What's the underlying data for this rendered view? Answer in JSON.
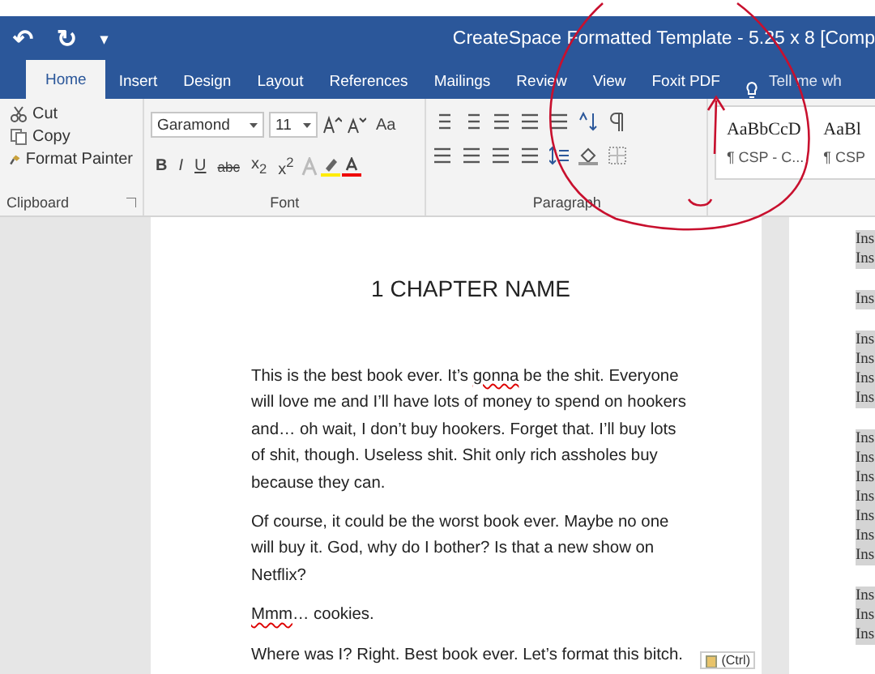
{
  "quick_access": {
    "undo": "↶",
    "redo": "↻",
    "customize": "▾"
  },
  "window": {
    "title": "CreateSpace Formatted Template - 5.25 x 8 [Comp"
  },
  "tabs": [
    {
      "label": "Home",
      "selected": true
    },
    {
      "label": "Insert",
      "selected": false
    },
    {
      "label": "Design",
      "selected": false
    },
    {
      "label": "Layout",
      "selected": false
    },
    {
      "label": "References",
      "selected": false
    },
    {
      "label": "Mailings",
      "selected": false
    },
    {
      "label": "Review",
      "selected": false
    },
    {
      "label": "View",
      "selected": false
    },
    {
      "label": "Foxit PDF",
      "selected": false
    }
  ],
  "tell_me": "Tell me wh",
  "clipboard": {
    "label": "Clipboard",
    "commands": [
      {
        "kind": "cut",
        "label": "Cut"
      },
      {
        "kind": "copy",
        "label": "Copy"
      },
      {
        "kind": "painter",
        "label": "Format Painter"
      }
    ]
  },
  "font": {
    "label": "Font",
    "family": "Garamond",
    "size": "11",
    "case": "Aa",
    "format_buttons": [
      "B",
      "I",
      "U",
      "abc",
      "x$_{2}$",
      "x$^{2}$"
    ]
  },
  "paragraph": {
    "label": "Paragraph"
  },
  "styles": [
    {
      "sample": "AaBbCcD",
      "name": "¶ CSP - C..."
    },
    {
      "sample": "AaBl",
      "name": "¶ CSP"
    }
  ],
  "document": {
    "heading": "1 CHAPTER NAME",
    "paragraphs": [
      [
        {
          "text": "This is the best book ever. It’s ",
          "misspelled": false
        },
        {
          "text": "gonna",
          "misspelled": true
        },
        {
          "text": " be the shit. Everyone will love me and I’ll have lots of money to spend on hookers and… oh wait, I don’t buy hookers. Forget that. I’ll buy lots of shit, though. Useless shit. Shit only rich assholes buy because they can.",
          "misspelled": false
        }
      ],
      [
        {
          "text": "Of course, it could be the worst book ever. Maybe no one will buy it. God, why do I bother? Is that a new show on Netflix?",
          "misspelled": false
        }
      ],
      [
        {
          "text": "Mmm",
          "misspelled": true
        },
        {
          "text": "… cookies.",
          "misspelled": false
        }
      ],
      [
        {
          "text": "Where was I? Right. Best book ever. Let’s format this bitch.",
          "misspelled": false
        }
      ]
    ],
    "paste_options": "(Ctrl)"
  },
  "side_page": {
    "groups": [
      [
        "Ins",
        "Ins"
      ],
      [
        "Ins"
      ],
      [
        "Ins",
        "Ins",
        "Ins",
        "Ins"
      ],
      [
        "Ins",
        "Ins",
        "Ins",
        "Ins",
        "Ins",
        "Ins",
        "Ins"
      ],
      [
        "Ins",
        "Ins",
        "Ins"
      ]
    ]
  }
}
